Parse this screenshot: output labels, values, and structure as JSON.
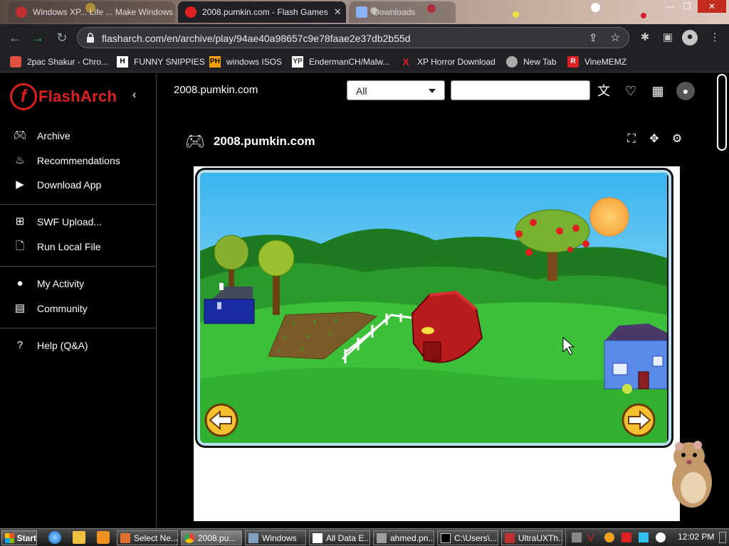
{
  "browser": {
    "tabs": [
      {
        "label": "Windows XP... Life ... Make Windows",
        "active": false
      },
      {
        "label": "2008.pumkin.com - Flash Games",
        "active": true
      },
      {
        "label": "Downloads",
        "active": false
      }
    ],
    "url": "flasharch.com/en/archive/play/94ae40a98657c9e78faae2e37db2b55d",
    "bookmarks": [
      {
        "label": "2pac Shakur - Chro...",
        "icon": "briefcase-icon"
      },
      {
        "label": "FUNNY SNIPPIES",
        "icon": "H"
      },
      {
        "label": "windows ISOS",
        "icon": "PH"
      },
      {
        "label": "EndermanCH/Malw...",
        "icon": "YP"
      },
      {
        "label": "XP Horror Download",
        "icon": "X"
      },
      {
        "label": "New Tab",
        "icon": "globe-icon"
      },
      {
        "label": "VineMEMZ",
        "icon": "R"
      }
    ]
  },
  "sidebar": {
    "logo_text": "FlashArch",
    "items": [
      {
        "label": "Archive",
        "icon": "gamepad-icon"
      },
      {
        "label": "Recommendations",
        "icon": "fire-icon"
      },
      {
        "label": "Download App",
        "icon": "tv-icon"
      },
      {
        "label": "SWF Upload...",
        "icon": "plus-box-icon"
      },
      {
        "label": "Run Local File",
        "icon": "file-icon"
      },
      {
        "label": "My Activity",
        "icon": "user-icon"
      },
      {
        "label": "Community",
        "icon": "chat-icon"
      },
      {
        "label": "Help (Q&A)",
        "icon": "help-icon"
      }
    ]
  },
  "header": {
    "title": "2008.pumkin.com",
    "category_selected": "All",
    "search_value": ""
  },
  "game": {
    "title": "2008.pumkin.com"
  },
  "taskbar": {
    "start_label": "Start",
    "tasks": [
      {
        "label": "Select Ne...",
        "active": false
      },
      {
        "label": "2008.pu...",
        "active": true
      },
      {
        "label": "Windows",
        "active": false
      },
      {
        "label": "All Data E...",
        "active": false
      },
      {
        "label": "ahmed.pn...",
        "active": false
      },
      {
        "label": "C:\\Users\\...",
        "active": false
      },
      {
        "label": "UltraUXTh...",
        "active": false
      }
    ],
    "clock": "12:02 PM"
  },
  "colors": {
    "accent": "#e02020",
    "sky": "#4fc3f7",
    "grass": "#22a030",
    "barn": "#b81c1c"
  }
}
